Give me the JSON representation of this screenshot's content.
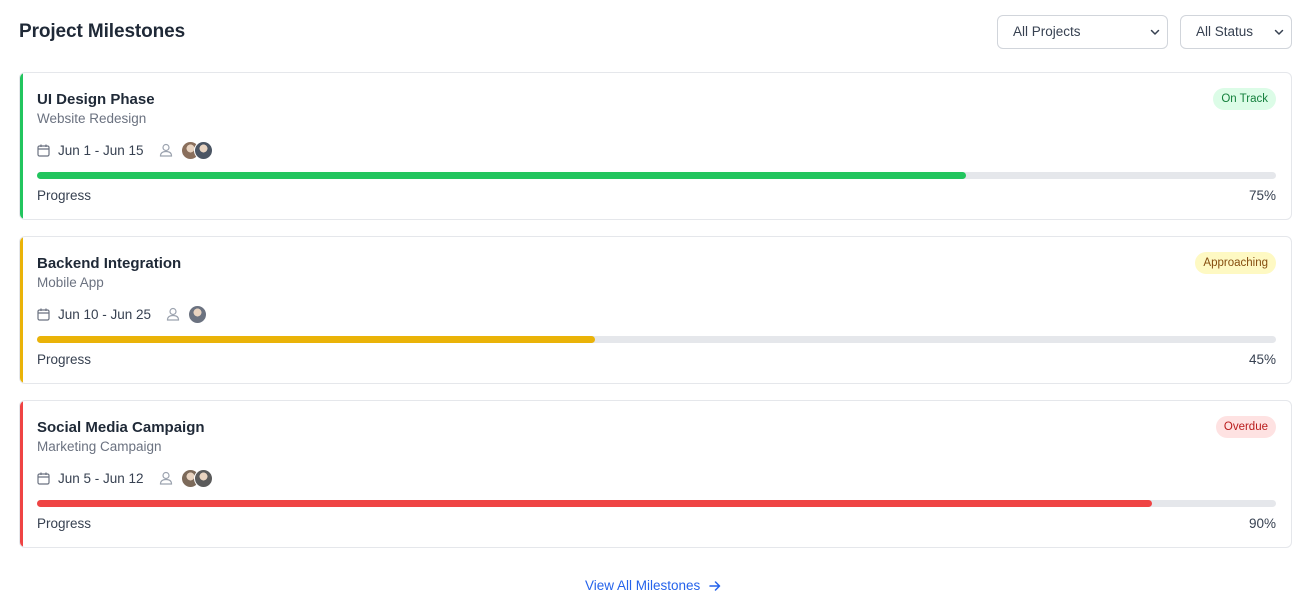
{
  "header": {
    "title": "Project Milestones"
  },
  "filters": {
    "project": "All Projects",
    "status": "All Status"
  },
  "milestones": [
    {
      "title": "UI Design Phase",
      "project": "Website Redesign",
      "status": "On Track",
      "dates": "Jun 1 - Jun 15",
      "progress_label": "Progress",
      "progress_text": "75%",
      "progress": 75,
      "color": "#22c55e",
      "badge_bg": "#dcfce7",
      "badge_fg": "#15803d",
      "avatars": [
        "#8a6f5c",
        "#4b5563"
      ]
    },
    {
      "title": "Backend Integration",
      "project": "Mobile App",
      "status": "Approaching",
      "dates": "Jun 10 - Jun 25",
      "progress_label": "Progress",
      "progress_text": "45%",
      "progress": 45,
      "color": "#eab308",
      "badge_bg": "#fef9c3",
      "badge_fg": "#854d0e",
      "avatars": [
        "#6b7280"
      ]
    },
    {
      "title": "Social Media Campaign",
      "project": "Marketing Campaign",
      "status": "Overdue",
      "dates": "Jun 5 - Jun 12",
      "progress_label": "Progress",
      "progress_text": "90%",
      "progress": 90,
      "color": "#ef4444",
      "badge_bg": "#fee2e2",
      "badge_fg": "#b91c1c",
      "avatars": [
        "#7c6a5a",
        "#5b5b5b"
      ]
    }
  ],
  "footer": {
    "view_all": "View All Milestones"
  }
}
